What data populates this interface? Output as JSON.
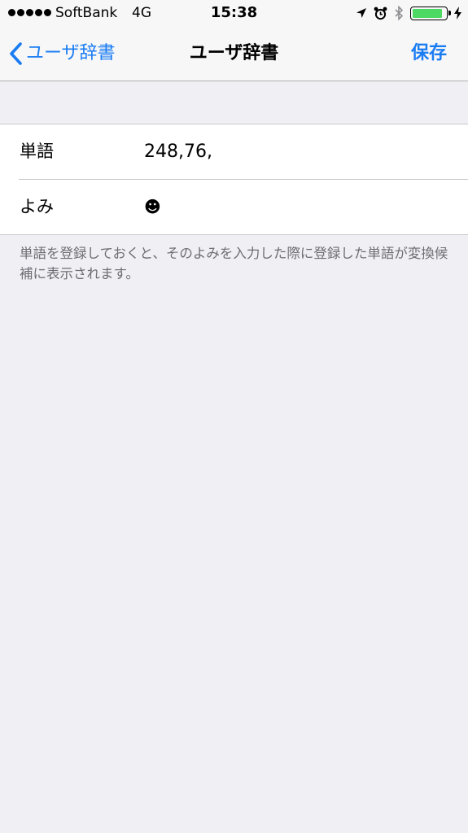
{
  "status_bar": {
    "carrier": "SoftBank",
    "network": "4G",
    "time": "15:38",
    "icons": [
      "location-arrow-icon",
      "alarm-clock-icon",
      "bluetooth-icon",
      "battery-icon",
      "charging-bolt-icon"
    ],
    "battery_level": 0.9,
    "battery_color": "#4cd964"
  },
  "nav": {
    "back_label": "ユーザ辞書",
    "title": "ユーザ辞書",
    "save_label": "保存",
    "accent_color": "#1a7cf2"
  },
  "form": {
    "word_label": "単語",
    "word_value": "248,76,",
    "reading_label": "よみ",
    "reading_value": "☻"
  },
  "footer_note": "単語を登録しておくと、そのよみを入力した際に登録した単語が変換候補に表示されます。"
}
